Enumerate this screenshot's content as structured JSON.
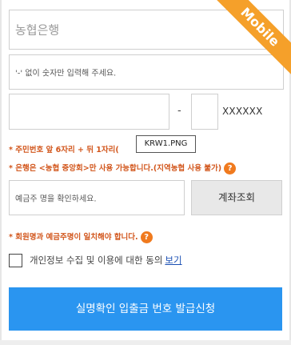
{
  "badge": {
    "label": "Mobile"
  },
  "form": {
    "bank_placeholder": "농협은행",
    "account_placeholder": "'-' 없이 숫자만 입력해 주세요.",
    "rrn_separator": "-",
    "rrn_mask": "XXXXXX",
    "holder_placeholder": "예금주 명을 확인하세요.",
    "inquiry_button": "계좌조회",
    "consent_label": "개인정보 수집 및 이용에 대한 동의",
    "consent_link": "보기",
    "submit_button": "실명확인 입출금 번호 발급신청"
  },
  "notes": {
    "rrn": "* 주민번호 앞 6자리 + 뒤 1자리(",
    "bank": "* 은행은 <농협 중앙회>만 사용 가능합니다.(지역농협 사용 불가)",
    "name": "* 회원명과 예금주명이 일치해야 합니다.",
    "help_glyph": "?"
  },
  "tooltip": {
    "text": "KRW1.PNG"
  },
  "colors": {
    "accent": "#2a95f0",
    "warning": "#d2561c",
    "ribbon": "#f5a02a"
  }
}
